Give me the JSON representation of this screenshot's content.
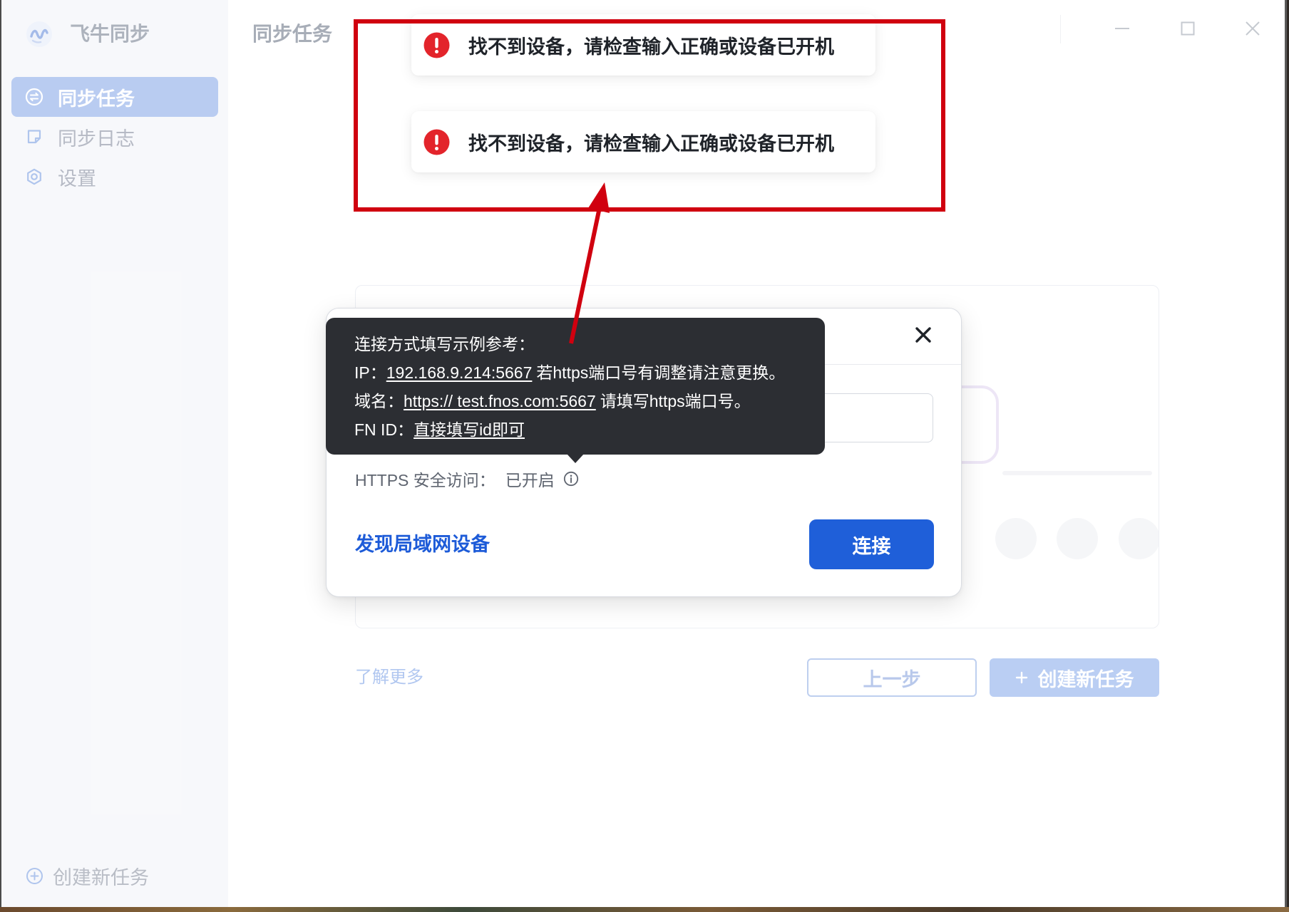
{
  "app": {
    "name": "飞牛同步",
    "logo_icon": "app-logo-icon"
  },
  "header": {
    "title": "同步任务"
  },
  "window_controls": [
    "minimize-icon",
    "maximize-icon",
    "close-icon"
  ],
  "sidebar": {
    "items": [
      {
        "label": "同步任务",
        "icon": "sync-icon",
        "active": true
      },
      {
        "label": "同步日志",
        "icon": "note-icon",
        "active": false
      },
      {
        "label": "设置",
        "icon": "gear-icon",
        "active": false
      }
    ],
    "footer": {
      "label": "创建新任务",
      "icon": "plus-circle-icon"
    }
  },
  "main": {
    "learn_more": "了解更多",
    "prev_button": "上一步",
    "create_button": {
      "label": "创建新任务",
      "icon": "plus-icon"
    }
  },
  "modal": {
    "close_icon": "close-icon",
    "https": {
      "label": "HTTPS 安全访问：",
      "status": "已开启",
      "icon": "info-icon"
    },
    "discover_link": "发现局域网设备",
    "connect_button": "连接"
  },
  "tooltip": {
    "title": "连接方式填写示例参考：",
    "lines": [
      {
        "prefix": "IP：",
        "value": "192.168.9.214:5667",
        "suffix": "若https端口号有调整请注意更换。"
      },
      {
        "prefix": "域名：",
        "value": "https:// test.fnos.com:5667",
        "suffix": "请填写https端口号。"
      },
      {
        "prefix": "FN ID：",
        "value": "直接填写id即可",
        "suffix": ""
      }
    ]
  },
  "toasts": [
    {
      "type": "error",
      "icon": "error-icon",
      "message": "找不到设备，请检查输入正确或设备已开机"
    },
    {
      "type": "error",
      "icon": "error-icon",
      "message": "找不到设备，请检查输入正确或设备已开机"
    }
  ],
  "colors": {
    "accent": "#1f5fd9",
    "link": "#1d5bd8",
    "error": "#e3242b",
    "tooltip_bg": "#2c2e33",
    "annotation": "#d0000f",
    "sidebar_active": "#b3c8f0"
  }
}
